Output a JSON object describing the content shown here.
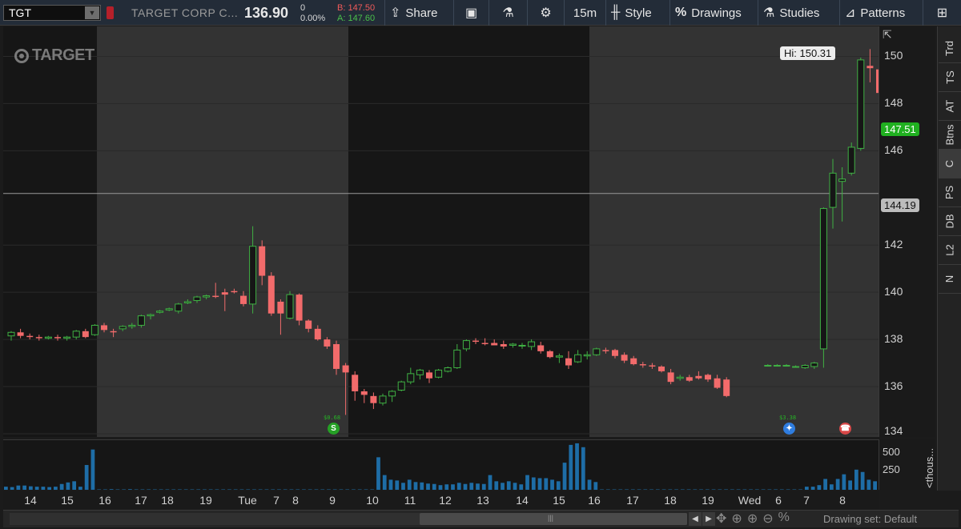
{
  "toolbar": {
    "symbol": "TGT",
    "company": "TARGET CORP C...",
    "last": "136.90",
    "change": "0",
    "change_pct": "0.00%",
    "bid": "B: 147.50",
    "ask": "A: 147.60",
    "share_label": "Share",
    "timeframe": "15m",
    "style_label": "Style",
    "drawings_label": "Drawings",
    "studies_label": "Studies",
    "patterns_label": "Patterns"
  },
  "logo_text": "TARGET",
  "right_tabs": [
    "Trd",
    "TS",
    "AT",
    "Btns",
    "C",
    "PS",
    "DB",
    "L2",
    "N"
  ],
  "active_tab": "C",
  "price_axis": {
    "ticks": [
      "150",
      "148",
      "146",
      "142",
      "140",
      "138",
      "136",
      "134"
    ],
    "current_price_badge": "147.51",
    "crosshair_badge": "144.19",
    "high_tag": "Hi: 150.31"
  },
  "volume_axis": {
    "ticks": [
      "500",
      "250"
    ],
    "unit_label": "<thous..."
  },
  "time_axis": {
    "labels": [
      "14",
      "15",
      "16",
      "17",
      "18",
      "19",
      "Tue",
      "7",
      "8",
      "9",
      "10",
      "11",
      "12",
      "13",
      "14",
      "15",
      "16",
      "17",
      "18",
      "19",
      "Wed",
      "6",
      "7",
      "8"
    ]
  },
  "events": {
    "dividend1_label": "$0.68",
    "dividend2_label": "$3.38",
    "dividend_icon": "S",
    "earnings_icon": "lightbulb-icon",
    "conference_icon": "phone-icon"
  },
  "scrollbar": {
    "drawing_set": "Drawing set: Default"
  },
  "colors": {
    "up": "#3fb043",
    "down": "#f26b6b",
    "volume": "#1e6da6",
    "toolbar_bg": "#232c38"
  },
  "chart_data": {
    "type": "candlestick",
    "ylim": [
      134,
      151
    ],
    "candles": [
      [
        138.15,
        138.35,
        137.95,
        138.3
      ],
      [
        138.3,
        138.45,
        138.05,
        138.15
      ],
      [
        138.15,
        138.25,
        138.0,
        138.1
      ],
      [
        138.1,
        138.2,
        137.95,
        138.05
      ],
      [
        138.05,
        138.15,
        138.0,
        138.1
      ],
      [
        138.1,
        138.2,
        137.95,
        138.05
      ],
      [
        138.05,
        138.15,
        137.95,
        138.1
      ],
      [
        138.1,
        138.4,
        138.0,
        138.35
      ],
      [
        138.35,
        138.45,
        138.05,
        138.1
      ],
      [
        138.2,
        138.65,
        138.15,
        138.6
      ],
      [
        138.6,
        138.7,
        138.3,
        138.4
      ],
      [
        138.35,
        138.45,
        138.1,
        138.3
      ],
      [
        138.45,
        138.6,
        138.35,
        138.55
      ],
      [
        138.55,
        138.7,
        138.45,
        138.6
      ],
      [
        138.6,
        139.05,
        138.5,
        139.0
      ],
      [
        139.0,
        139.1,
        138.85,
        139.05
      ],
      [
        139.15,
        139.25,
        139.1,
        139.2
      ],
      [
        139.25,
        139.35,
        139.2,
        139.3
      ],
      [
        139.2,
        139.55,
        139.1,
        139.5
      ],
      [
        139.55,
        139.7,
        139.5,
        139.6
      ],
      [
        139.65,
        139.85,
        139.55,
        139.8
      ],
      [
        139.8,
        139.9,
        139.7,
        139.85
      ],
      [
        139.85,
        140.4,
        139.75,
        139.8
      ],
      [
        140.0,
        140.15,
        139.2,
        139.9
      ],
      [
        140.05,
        140.15,
        139.95,
        140.0
      ],
      [
        139.85,
        140.05,
        139.4,
        139.5
      ],
      [
        139.5,
        142.8,
        139.1,
        141.95
      ],
      [
        141.95,
        142.2,
        140.3,
        140.7
      ],
      [
        140.7,
        140.85,
        139.0,
        139.1
      ],
      [
        139.6,
        139.7,
        138.2,
        139.1
      ],
      [
        138.9,
        140.05,
        138.85,
        139.9
      ],
      [
        139.9,
        139.95,
        138.6,
        138.8
      ],
      [
        138.8,
        138.85,
        138.3,
        138.45
      ],
      [
        138.45,
        138.6,
        137.95,
        138.0
      ],
      [
        138.0,
        138.1,
        137.6,
        137.7
      ],
      [
        137.8,
        137.95,
        136.5,
        136.75
      ],
      [
        136.9,
        137.0,
        134.8,
        136.6
      ],
      [
        136.5,
        136.65,
        135.4,
        135.8
      ],
      [
        135.8,
        135.9,
        135.3,
        135.65
      ],
      [
        135.6,
        135.75,
        135.05,
        135.3
      ],
      [
        135.3,
        135.7,
        135.2,
        135.6
      ],
      [
        135.6,
        135.85,
        135.35,
        135.8
      ],
      [
        135.85,
        136.25,
        135.8,
        136.2
      ],
      [
        136.2,
        136.8,
        136.1,
        136.55
      ],
      [
        136.5,
        136.75,
        136.3,
        136.7
      ],
      [
        136.6,
        136.7,
        136.15,
        136.35
      ],
      [
        136.4,
        136.75,
        136.35,
        136.7
      ],
      [
        136.65,
        136.85,
        136.6,
        136.8
      ],
      [
        136.8,
        137.8,
        136.75,
        137.55
      ],
      [
        137.6,
        138.0,
        137.5,
        137.95
      ],
      [
        137.95,
        138.05,
        137.8,
        137.9
      ],
      [
        137.85,
        138.05,
        137.75,
        137.8
      ],
      [
        137.85,
        138.0,
        137.75,
        137.75
      ],
      [
        137.8,
        137.95,
        137.6,
        137.7
      ],
      [
        137.75,
        137.85,
        137.65,
        137.8
      ],
      [
        137.75,
        137.85,
        137.6,
        137.75
      ],
      [
        137.7,
        138.0,
        137.55,
        137.9
      ],
      [
        137.75,
        137.9,
        137.4,
        137.5
      ],
      [
        137.5,
        137.55,
        137.2,
        137.25
      ],
      [
        137.25,
        137.4,
        137.0,
        137.3
      ],
      [
        137.2,
        137.5,
        136.75,
        136.9
      ],
      [
        137.05,
        137.55,
        137.0,
        137.35
      ],
      [
        137.3,
        137.5,
        137.15,
        137.35
      ],
      [
        137.35,
        137.65,
        137.3,
        137.6
      ],
      [
        137.55,
        137.65,
        137.4,
        137.5
      ],
      [
        137.55,
        137.6,
        137.2,
        137.3
      ],
      [
        137.35,
        137.45,
        137.0,
        137.1
      ],
      [
        137.2,
        137.3,
        136.9,
        136.95
      ],
      [
        136.95,
        137.05,
        136.8,
        136.9
      ],
      [
        136.9,
        137.0,
        136.75,
        136.85
      ],
      [
        136.85,
        136.9,
        136.6,
        136.65
      ],
      [
        136.6,
        136.75,
        136.1,
        136.2
      ],
      [
        136.35,
        136.5,
        136.25,
        136.4
      ],
      [
        136.4,
        136.5,
        136.2,
        136.25
      ],
      [
        136.45,
        136.65,
        136.3,
        136.35
      ],
      [
        136.5,
        136.55,
        136.2,
        136.3
      ],
      [
        136.35,
        136.5,
        135.9,
        135.95
      ],
      [
        136.3,
        136.4,
        135.55,
        135.6
      ],
      [
        136.9,
        136.95,
        136.85,
        136.9
      ],
      [
        136.9,
        136.95,
        136.85,
        136.9
      ],
      [
        136.9,
        136.95,
        136.85,
        136.9
      ],
      [
        136.85,
        136.9,
        136.8,
        136.85
      ],
      [
        136.8,
        136.95,
        136.75,
        136.9
      ],
      [
        136.85,
        137.05,
        136.75,
        137.0
      ],
      [
        137.6,
        143.6,
        136.8,
        143.55
      ],
      [
        143.6,
        145.65,
        142.7,
        145.05
      ],
      [
        144.7,
        145.3,
        143.0,
        144.8
      ],
      [
        145.05,
        146.35,
        144.95,
        146.15
      ],
      [
        146.1,
        149.95,
        146.0,
        149.85
      ],
      [
        149.6,
        150.31,
        148.9,
        149.5
      ],
      [
        149.45,
        149.65,
        148.4,
        148.45
      ],
      [
        148.5,
        148.7,
        148.3,
        148.6
      ],
      [
        148.4,
        148.75,
        147.3,
        147.3
      ],
      [
        147.2,
        147.6,
        147.0,
        147.51
      ]
    ],
    "volume": [
      40,
      35,
      55,
      55,
      45,
      40,
      40,
      35,
      40,
      75,
      95,
      110,
      40,
      320,
      520,
      5,
      5,
      8,
      5,
      5,
      8,
      5,
      5,
      5,
      5,
      5,
      5,
      5,
      5,
      5,
      5,
      5,
      5,
      5,
      5,
      5,
      5,
      5,
      5,
      5,
      5,
      5,
      5,
      5,
      5,
      5,
      5,
      5,
      5,
      5,
      5,
      5,
      5,
      5,
      5,
      5,
      5,
      5,
      5,
      5,
      420,
      190,
      130,
      120,
      90,
      130,
      100,
      95,
      80,
      75,
      60,
      70,
      70,
      90,
      75,
      90,
      80,
      75,
      190,
      110,
      90,
      110,
      90,
      70,
      190,
      160,
      150,
      150,
      130,
      110,
      350,
      580,
      600,
      550,
      130,
      100,
      5,
      5,
      5,
      5,
      5,
      5,
      5,
      5,
      5,
      5,
      5,
      5,
      5,
      5,
      5,
      5,
      5,
      5,
      5,
      5,
      5,
      5,
      5,
      5,
      5,
      5,
      5,
      5,
      5,
      5,
      5,
      5,
      5,
      40,
      40,
      60,
      140,
      70,
      140,
      200,
      120,
      260,
      230,
      130,
      110
    ]
  }
}
